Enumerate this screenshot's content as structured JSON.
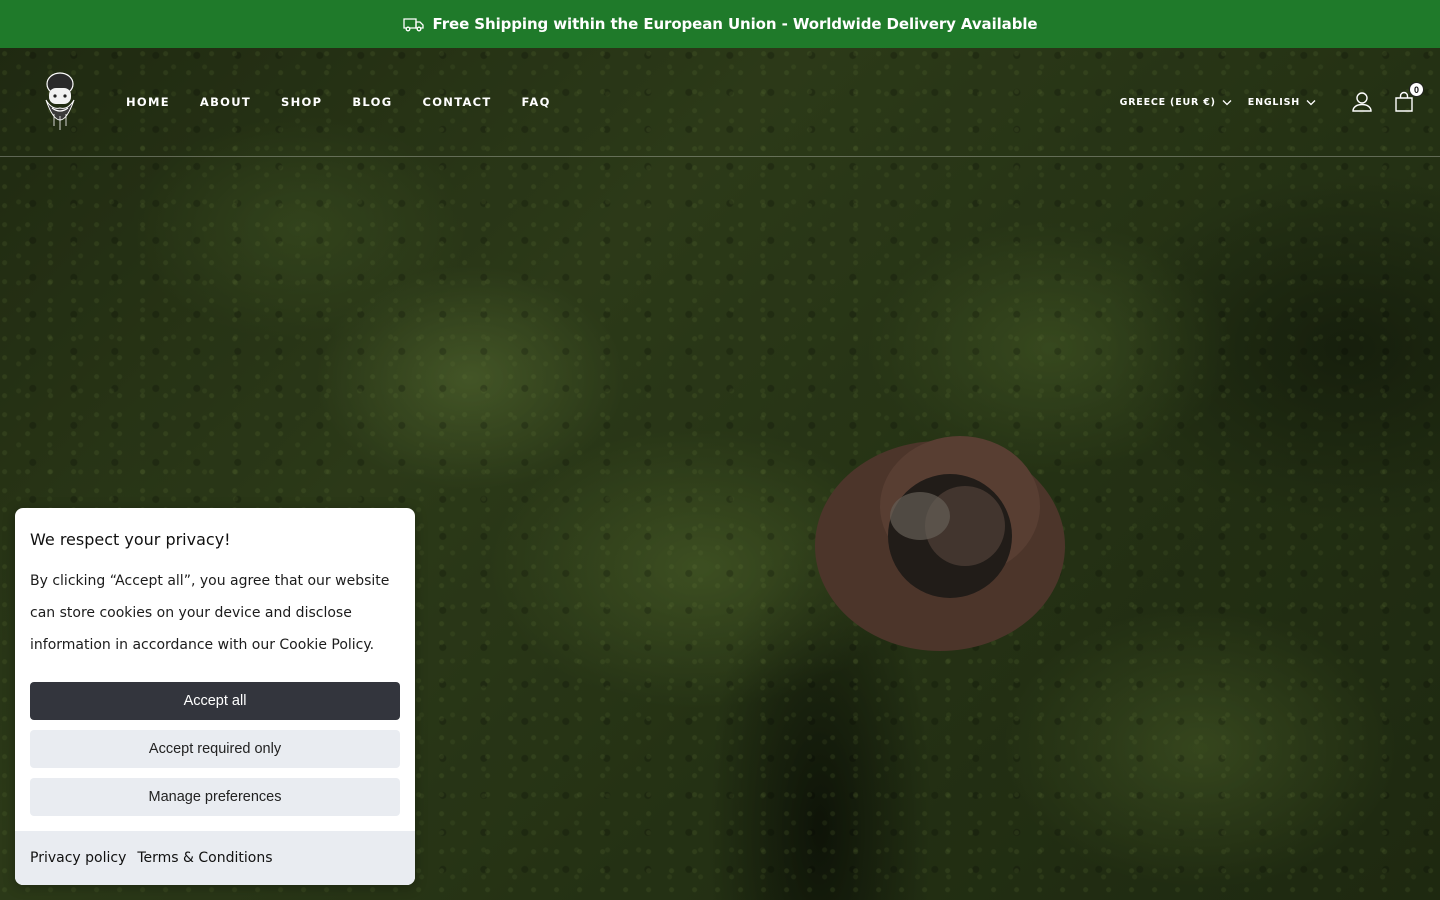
{
  "announcement": {
    "text": "Free Shipping within the European Union - Worldwide Delivery Available",
    "icon": "truck-icon"
  },
  "header": {
    "nav": [
      {
        "label": "HOME"
      },
      {
        "label": "ABOUT"
      },
      {
        "label": "SHOP"
      },
      {
        "label": "BLOG"
      },
      {
        "label": "CONTACT"
      },
      {
        "label": "FAQ"
      }
    ],
    "country_selector": "GREECE (EUR €)",
    "language_selector": "ENGLISH",
    "cart_count": "0"
  },
  "cookie_banner": {
    "title": "We respect your privacy!",
    "body": "By clicking “Accept all”, you agree that our website can store cookies on your device and disclose information in accordance with our Cookie Policy.",
    "accept_all": "Accept all",
    "accept_required": "Accept required only",
    "manage_preferences": "Manage preferences",
    "privacy_policy": "Privacy policy",
    "terms": "Terms & Conditions"
  },
  "colors": {
    "announcement_bg": "#1f7a2a",
    "primary_button": "#33353d",
    "secondary_button": "#e9ecf1"
  }
}
